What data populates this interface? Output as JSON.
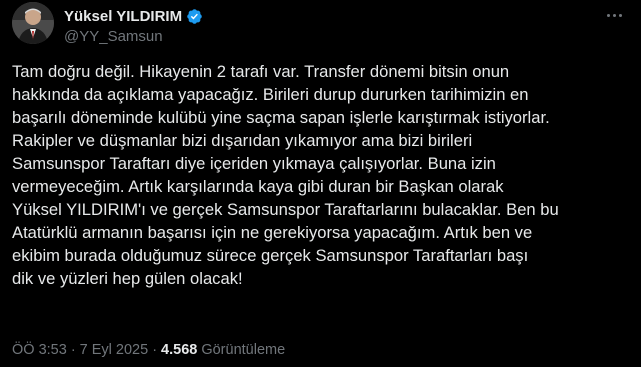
{
  "author": {
    "display_name": "Yüksel YILDIRIM",
    "handle": "@YY_Samsun",
    "verified": true
  },
  "tweet": {
    "lines": [
      "Tam doğru değil. Hikayenin 2 tarafı var. Transfer dönemi bitsin onun",
      "hakkında da açıklama yapacağız. Birileri durup dururken tarihimizin en",
      "başarılı döneminde kulübü yine saçma sapan işlerle karıştırmak istiyorlar.",
      "Rakipler ve düşmanlar bizi dışarıdan yıkamıyor ama bizi birileri",
      "Samsunspor Taraftarı diye içeriden yıkmaya çalışıyorlar. Buna izin",
      "vermeyeceğim. Artık karşılarında kaya gibi duran bir Başkan olarak",
      "Yüksel YILDIRIM'ı ve gerçek Samsunspor Taraftarlarını bulacaklar. Ben bu",
      "Atatürklü armanın başarısı için ne gerekiyorsa yapacağım. Artık ben ve",
      "ekibim burada olduğumuz sürece  gerçek Samsunspor Taraftarları başı",
      "dik ve yüzleri hep gülen olacak!"
    ]
  },
  "meta": {
    "time": "ÖÖ 3:53",
    "separator": "·",
    "date": "7 Eyl 2025",
    "views_count": "4.568",
    "views_label": "Görüntüleme"
  },
  "icons": {
    "verified": "verified-badge-icon",
    "more": "more-horizontal-icon",
    "avatar": "profile-photo"
  },
  "colors": {
    "background": "#000000",
    "text_primary": "#e7e9ea",
    "text_secondary": "#71767b",
    "verified_blue": "#1d9bf0"
  }
}
